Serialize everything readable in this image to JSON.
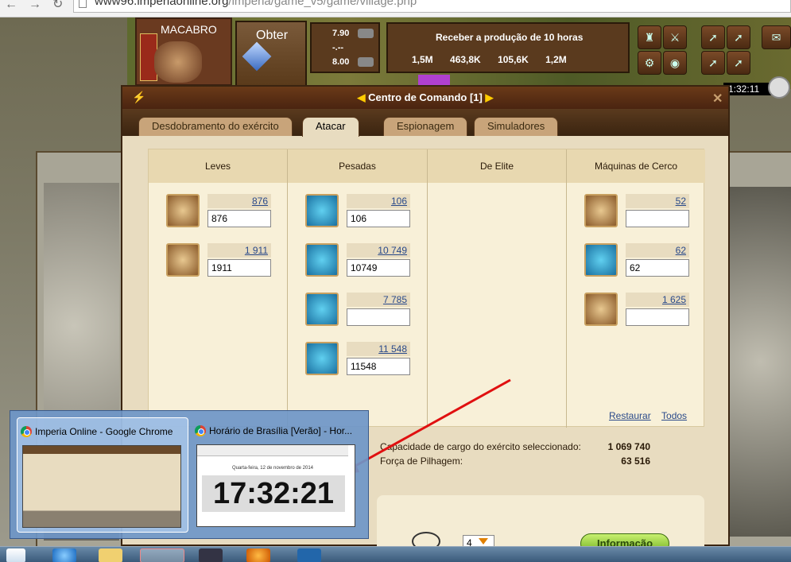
{
  "browser": {
    "url_host": "www96.imperiaonline.org",
    "url_path": "/imperia/game_v5/game/village.php"
  },
  "hud": {
    "player_name": "MACABRO",
    "obter_label": "Obter",
    "rates": [
      "7.90",
      "-.--",
      "8.00"
    ],
    "production_title": "Receber a produção de 10 horas",
    "production_values": [
      "1,5M",
      "463,8K",
      "105,6K",
      "1,2M"
    ],
    "clock": "1:32:11"
  },
  "dialog": {
    "title": "Centro de Comando [1]",
    "tabs": [
      "Desdobramento do exército",
      "Atacar",
      "Espionagem",
      "Simuladores"
    ],
    "active_tab": "Atacar",
    "columns": [
      "Leves",
      "Pesadas",
      "De Elite",
      "Máquinas de Cerco"
    ],
    "units": {
      "light": [
        {
          "available": "876",
          "input": "876"
        },
        {
          "available": "1 911",
          "input": "1911"
        }
      ],
      "heavy": [
        {
          "available": "106",
          "input": "106"
        },
        {
          "available": "10 749",
          "input": "10749"
        },
        {
          "available": "7 785",
          "input": ""
        },
        {
          "available": "11 548",
          "input": "11548"
        }
      ],
      "siege": [
        {
          "available": "52",
          "input": ""
        },
        {
          "available": "62",
          "input": "62"
        },
        {
          "available": "1 625",
          "input": ""
        }
      ]
    },
    "links": {
      "reset": "Restaurar",
      "all": "Todos"
    },
    "capacity_label": "Capacidade de cargo do exército seleccionado:",
    "capacity_value": "1 069 740",
    "pillage_label": "Força de Pilhagem:",
    "pillage_value": "63 516",
    "formation_select": "4",
    "info_button": "Informação"
  },
  "preview": {
    "thumb1_title": "Imperia Online - Google Chrome",
    "thumb2_title": "Horário de Brasília [Verão] - Hor...",
    "thumb2_date": "Quarta-feira, 12 de novembro de 2014",
    "thumb2_time": "17:32:21"
  },
  "colors": {
    "dialog_bg": "#e8dcc0",
    "titlebar": "#4a2410",
    "link_blue": "#2a4a8a",
    "arrow_red": "#e01010",
    "info_green": "#70b020"
  }
}
